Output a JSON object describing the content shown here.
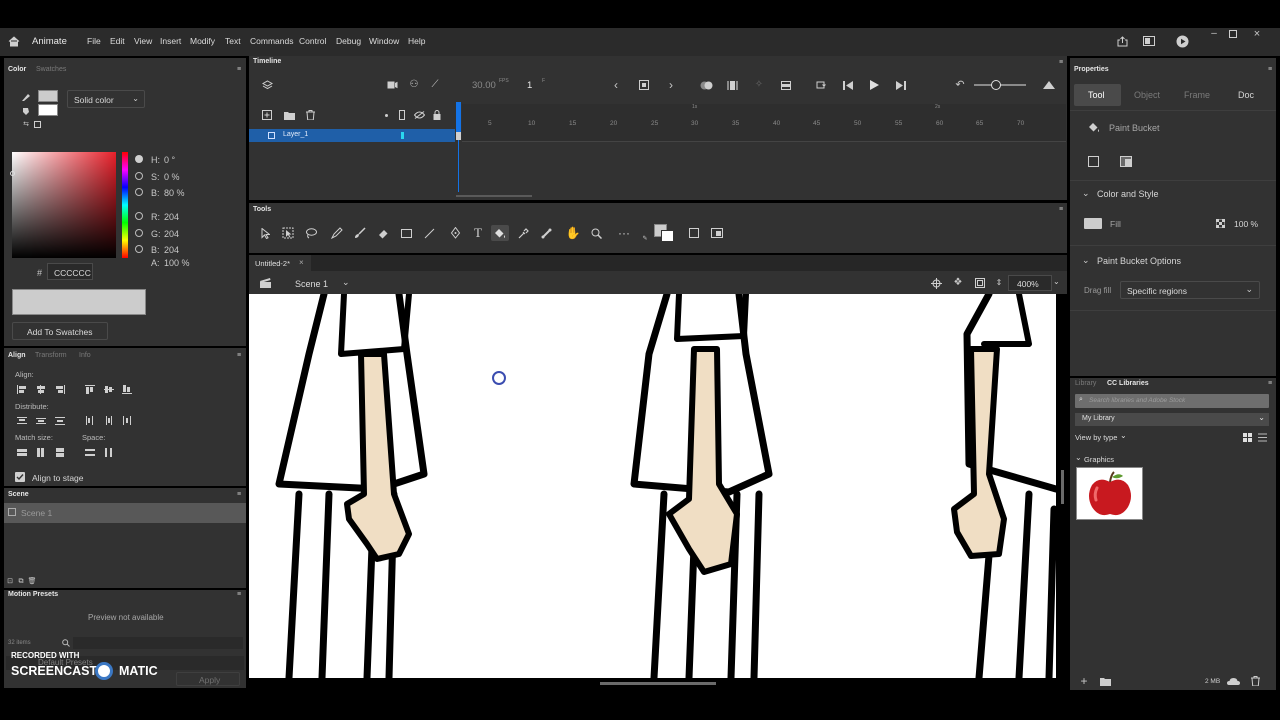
{
  "app": {
    "name": "Animate",
    "menus": [
      "File",
      "Edit",
      "View",
      "Insert",
      "Modify",
      "Text",
      "Commands",
      "Control",
      "Debug",
      "Window",
      "Help"
    ]
  },
  "color_panel": {
    "tab_color": "Color",
    "tab_swatches": "Swatches",
    "fill_type": "Solid color",
    "h_label": "H:",
    "h_value": "0 °",
    "s_label": "S:",
    "s_value": "0 %",
    "b_label": "B:",
    "b_value": "80 %",
    "r_label": "R:",
    "r_value": "204",
    "g_label": "G:",
    "g_value": "204",
    "bl_label": "B:",
    "bl_value": "204",
    "a_label": "A:",
    "a_value": "100 %",
    "hash": "#",
    "hex": "CCCCCC",
    "preview_color": "#cccccc",
    "add_swatches": "Add To Swatches"
  },
  "align_panel": {
    "tab_align": "Align",
    "tab_transform": "Transform",
    "tab_info": "Info",
    "align_label": "Align:",
    "distribute_label": "Distribute:",
    "match_size_label": "Match size:",
    "space_label": "Space:",
    "align_to_stage": "Align to stage"
  },
  "scene_panel": {
    "title": "Scene",
    "item": "Scene 1"
  },
  "motion_presets": {
    "title": "Motion Presets",
    "preview": "Preview not available",
    "count": "32 items",
    "folder": "Default Presets",
    "apply": "Apply"
  },
  "watermark": {
    "line1": "RECORDED WITH",
    "brand_left": "SCREENCAST",
    "brand_right": "MATIC"
  },
  "timeline": {
    "title": "Timeline",
    "fps": "30.00",
    "fps_unit": "FPS",
    "frame": "1",
    "frame_unit": "F",
    "layer_name": "Layer_1",
    "ruler": [
      "5",
      "10",
      "15",
      "20",
      "25",
      "30",
      "35",
      "40",
      "45",
      "50",
      "55",
      "60",
      "65",
      "70"
    ],
    "sec_marks": [
      "1s",
      "2s"
    ]
  },
  "tools_panel": {
    "title": "Tools"
  },
  "document": {
    "tab": "Untitled-2*",
    "close": "×",
    "scene": "Scene 1",
    "zoom": "400%"
  },
  "properties": {
    "title": "Properties",
    "tabs": [
      "Tool",
      "Object",
      "Frame",
      "Doc"
    ],
    "tool_name": "Paint Bucket",
    "color_style": "Color and Style",
    "fill_label": "Fill",
    "fill_opacity": "100 %",
    "bucket_options": "Paint Bucket Options",
    "drag_fill_label": "Drag fill",
    "drag_fill_value": "Specific regions"
  },
  "library": {
    "tab_library": "Library",
    "tab_cc": "CC Libraries",
    "search_placeholder": "Search libraries and Adobe Stock",
    "library_name": "My Library",
    "view_by": "View by type",
    "group": "Graphics",
    "size": "2 MB"
  },
  "colors": {
    "accent": "#1473e6",
    "layer_selected": "#1f5fa8",
    "panel": "#323232",
    "stage": "#ffffff",
    "skin": "#f0dec4"
  }
}
